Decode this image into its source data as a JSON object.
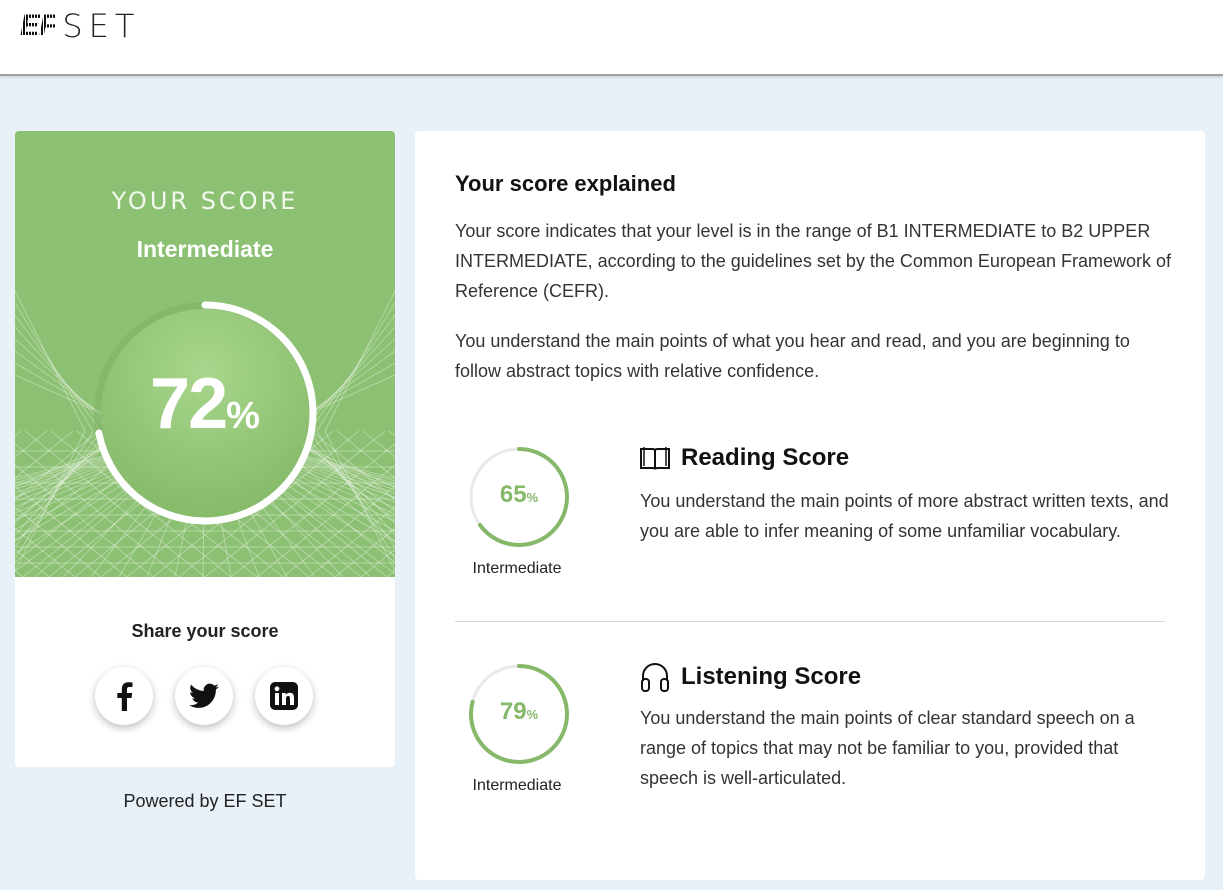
{
  "header": {
    "logo_ef": "EF",
    "logo_set": "SET"
  },
  "score_card": {
    "heading": "YOUR SCORE",
    "level": "Intermediate",
    "score_value": "72",
    "score_unit": "%",
    "score_fraction": 0.72,
    "share_title": "Share your score",
    "share_buttons": [
      "facebook-icon",
      "twitter-icon",
      "linkedin-icon"
    ],
    "powered_by": "Powered by EF SET"
  },
  "explanation": {
    "title": "Your score explained",
    "paragraph1": "Your score indicates that your level is in the range of B1 INTERMEDIATE to B2 UPPER INTERMEDIATE, according to the guidelines set by the Common European Framework of Reference (CEFR).",
    "paragraph2": "You understand the main points of what you hear and read, and you are beginning to follow abstract topics with relative confidence."
  },
  "reading": {
    "value": "65",
    "unit": "%",
    "fraction": 0.65,
    "level": "Intermediate",
    "title": "Reading Score",
    "icon": "book-icon",
    "description": "You understand the main points of more abstract written texts, and you are able to infer meaning of some unfamiliar vocabulary."
  },
  "listening": {
    "value": "79",
    "unit": "%",
    "fraction": 0.79,
    "level": "Intermediate",
    "title": "Listening Score",
    "icon": "headphones-icon",
    "description": "You understand the main points of clear standard speech on a range of topics that may not be familiar to you, provided that speech is well-articulated."
  },
  "colors": {
    "accent_green": "#8cc072",
    "ring_green": "#86b86a",
    "page_bg": "#e8f0f8"
  }
}
